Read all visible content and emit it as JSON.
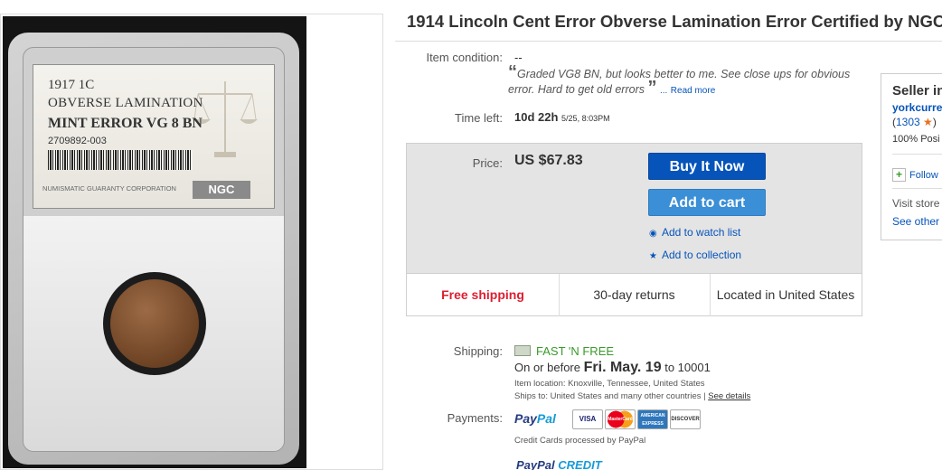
{
  "image_panel": {
    "label": {
      "year_denom": "1917 1C",
      "variety": "OBVERSE LAMINATION",
      "grade": "MINT ERROR VG 8 BN",
      "cert_number": "2709892-003",
      "corporation": "NUMISMATIC GUARANTY CORPORATION",
      "logo": "NGC"
    }
  },
  "listing": {
    "title": "1914 Lincoln Cent Error Obverse Lamination Error Certified by NGC",
    "condition_label": "Item condition:",
    "condition_value": "--",
    "quote_open": "“",
    "quote_text": "Graded VG8 BN, but looks better to me. See close ups for obvious error. Hard to get old errors",
    "quote_close": "”",
    "quote_ellipsis": "...",
    "read_more": "Read more",
    "time_left_label": "Time left:",
    "time_left_value": "10d 22h",
    "time_left_date": "5/25, 8:03PM"
  },
  "purchase": {
    "price_label": "Price:",
    "price_value": "US $67.83",
    "buy_it_now": "Buy It Now",
    "add_to_cart": "Add to cart",
    "watch_list": "Add to watch list",
    "collection": "Add to collection",
    "free_shipping": "Free shipping",
    "returns": "30-day returns",
    "location": "Located in United States"
  },
  "seller": {
    "heading": "Seller in",
    "name": "yorkcurre",
    "feedback_open": "(",
    "feedback_score": "1303",
    "feedback_close": ")",
    "positive": "100% Posi",
    "follow": "Follow",
    "visit_store": "Visit store",
    "see_other": "See other"
  },
  "shipping": {
    "label": "Shipping:",
    "fast_free": "FAST 'N FREE",
    "delivery_prefix": "On or before",
    "delivery_date": "Fri. May. 19",
    "delivery_suffix": "to 10001",
    "item_location": "Item location:  Knoxville, Tennessee, United States",
    "ships_to": "Ships to:  United States and many other countries |",
    "see_details": "See details"
  },
  "payments": {
    "label": "Payments:",
    "paypal_a": "Pay",
    "paypal_b": "Pal",
    "cards": [
      "VISA",
      "MasterCard",
      "AMERICAN EXPRESS",
      "DISCOVER"
    ],
    "note": "Credit Cards processed by PayPal",
    "credit_a": "PayPal",
    "credit_b": "CREDIT"
  },
  "colors": {
    "buy_now": "#0654ba",
    "add_to_cart": "#3a8fd6",
    "free_shipping": "#dd1e31",
    "fast_free": "#3a9a2a",
    "link": "#0654ba"
  }
}
